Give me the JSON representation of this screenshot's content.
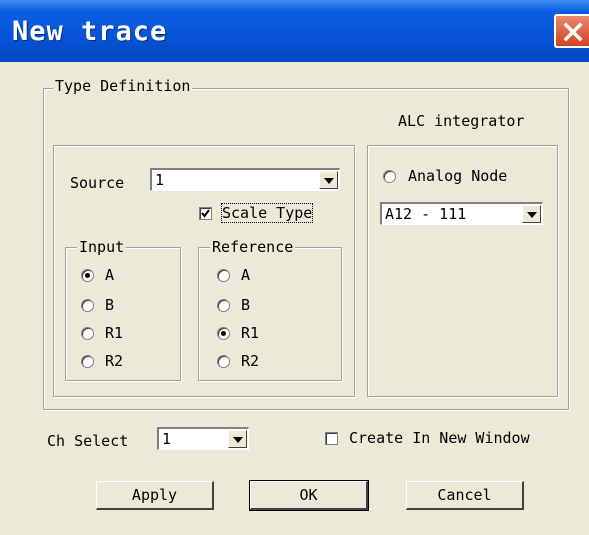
{
  "window": {
    "title": "New trace"
  },
  "type_definition": {
    "label": "Type Definition",
    "mode_label": "ALC integrator",
    "source": {
      "label": "Source",
      "value": "1"
    },
    "scale_type": {
      "label": "Scale Type",
      "checked": true
    },
    "input": {
      "label": "Input",
      "options": [
        "A",
        "B",
        "R1",
        "R2"
      ],
      "selected": "A"
    },
    "reference": {
      "label": "Reference",
      "options": [
        "A",
        "B",
        "R1",
        "R2"
      ],
      "selected": "R1"
    },
    "analog_node": {
      "label": "Analog Node",
      "selected": false,
      "value": "A12 - 111"
    }
  },
  "ch_select": {
    "label": "Ch Select",
    "value": "1"
  },
  "create_new_window": {
    "label": "Create In New Window",
    "checked": false
  },
  "buttons": {
    "apply": "Apply",
    "ok": "OK",
    "cancel": "Cancel"
  }
}
